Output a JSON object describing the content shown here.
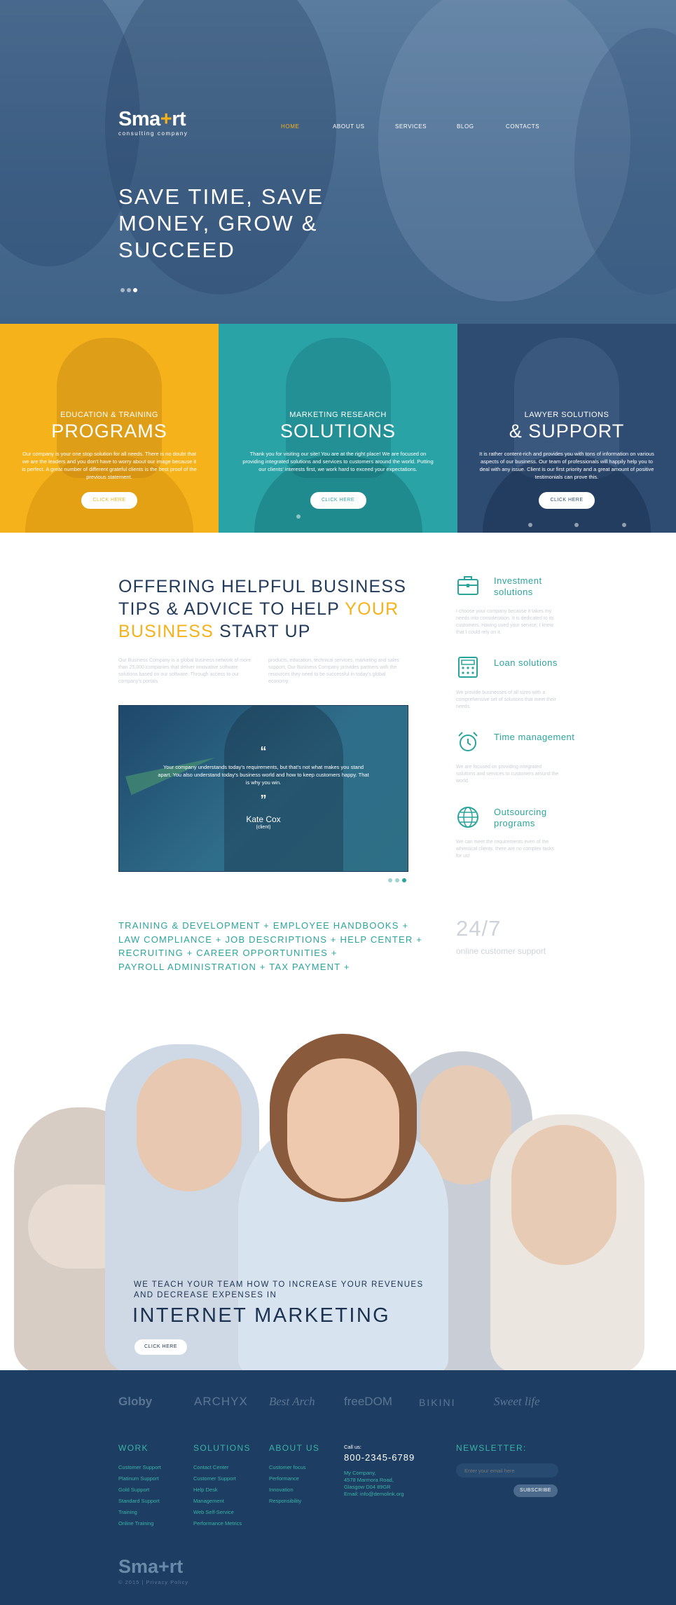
{
  "header": {
    "logo_main": "Sma",
    "logo_plus": "+",
    "logo_end": "rt",
    "logo_sub": "consulting company",
    "nav": [
      "HOME",
      "ABOUT US",
      "SERVICES",
      "BLOG",
      "CONTACTS"
    ],
    "active_nav": "HOME",
    "hero_title": "SAVE TIME, SAVE MONEY, GROW & SUCCEED",
    "slider_dots": 3,
    "active_slide": 2
  },
  "panels": [
    {
      "kicker": "EDUCATION & TRAINING",
      "title": "PROGRAMS",
      "text": "Our company is your one stop solution for all needs. There is no doubt that we are the leaders and you don't have to worry about our image because it is perfect. A great number of different grateful clients is the best proof of the previous statement.",
      "button": "CLICK HERE",
      "color": "#f5b21b"
    },
    {
      "kicker": "MARKETING RESEARCH",
      "title": "SOLUTIONS",
      "text": "Thank you for visiting our site! You are at the right place! We are focused on providing integrated solutions and services to customers around the world. Putting our clients' interests first, we work hard to exceed your expectations.",
      "button": "CLICK HERE",
      "color": "#2aa3a6"
    },
    {
      "kicker": "LAWYER SOLUTIONS",
      "title": "& SUPPORT",
      "text": "It is rather content-rich and provides you with tons of information on various aspects of our business. Our team of professionals will happily help you to deal with any issue. Client is our first priority and a great amount of positive testimonials can prove this.",
      "button": "CLICK HERE",
      "color": "#2e4c72"
    }
  ],
  "offer": {
    "title_part1": "OFFERING HELPFUL BUSINESS TIPS & ADVICE TO HELP ",
    "title_yellow": "YOUR BUSINESS",
    "title_part2": " START UP",
    "col1": "Our Business Company is a global business network of more than 25,000 companies that deliver innovative software solutions based on our software. Through access to our company's portals",
    "col2": "products, education, technical services, marketing and sales support, Our Business Company provides partners with the resources they need to be successful in today's global economy."
  },
  "testimonial": {
    "open_quote": "“",
    "close_quote": "”",
    "text": "Your company understands today's requirements, but that's not what makes you stand apart. You also understand today's business world and how to keep customers happy. That is why you win.",
    "name": "Kate Cox",
    "role": "(client)",
    "dots": 3,
    "active_dot": 3
  },
  "services": [
    {
      "icon": "briefcase-icon",
      "title": "Investment solutions",
      "desc": "I choose your company because it takes my needs into consideration. It is dedicated to its customers. Having used your service, I knew that I could rely on it."
    },
    {
      "icon": "calculator-icon",
      "title": "Loan solutions",
      "desc": "We provide businesses of all sizes with a comprehensive set of solutions that meet their needs."
    },
    {
      "icon": "alarm-clock-icon",
      "title": "Time management",
      "desc": "We are focused on providing integrated solutions and services to customers around the world."
    },
    {
      "icon": "globe-icon",
      "title": "Outsourcing programs",
      "desc": "We can meet the requirements even of the whimsical clients, there are no complex tasks for us!"
    }
  ],
  "tags": [
    "TRAINING & DEVELOPMENT + EMPLOYEE HANDBOOKS +",
    "LAW COMPLIANCE + JOB DESCRIPTIONS + HELP CENTER +",
    "RECRUITING + CAREER OPPORTUNITIES +",
    "PAYROLL ADMINISTRATION + TAX PAYMENT +"
  ],
  "support": {
    "big": "24/7",
    "small": "online customer support"
  },
  "team": {
    "kicker": "WE TEACH YOUR TEAM HOW TO INCREASE YOUR REVENUES AND DECREASE EXPENSES IN",
    "title": "INTERNET MARKETING",
    "button": "CLICK HERE"
  },
  "brands": [
    "Globy",
    "ARCHYX",
    "Best Arch",
    "freeDOM",
    "BIKINI",
    "Sweet life"
  ],
  "footer": {
    "work": {
      "heading": "WORK",
      "links": [
        "Customer Support",
        "Platinum Support",
        "Gold Support",
        "Standard Support",
        "Training",
        "Online Training"
      ]
    },
    "solutions": {
      "heading": "SOLUTIONS",
      "links": [
        "Contact Center",
        "Customer Support",
        "Help Desk",
        "Management",
        "Web Self-Service",
        "Performance Metrics"
      ]
    },
    "about": {
      "heading": "ABOUT US",
      "links": [
        "Customer focus",
        "Performance",
        "Innovation",
        "Responsibility"
      ]
    },
    "call_label": "Call us:",
    "phone": "800-2345-6789",
    "address_1": "My Company,",
    "address_2": "4578 Marmora Road,",
    "address_3": "Glasgow D04 89GR",
    "email": "Email: info@demolink.org",
    "newsletter_heading": "NEWSLETTER:",
    "newsletter_placeholder": "Enter your email here",
    "subscribe": "SUBSCRIBE",
    "logo": "Sma+rt",
    "copyright": "© 2015 | Privacy Policy"
  },
  "colors": {
    "accent": "#f5b21b",
    "teal": "#2aa59c",
    "navy": "#1d3e62"
  }
}
